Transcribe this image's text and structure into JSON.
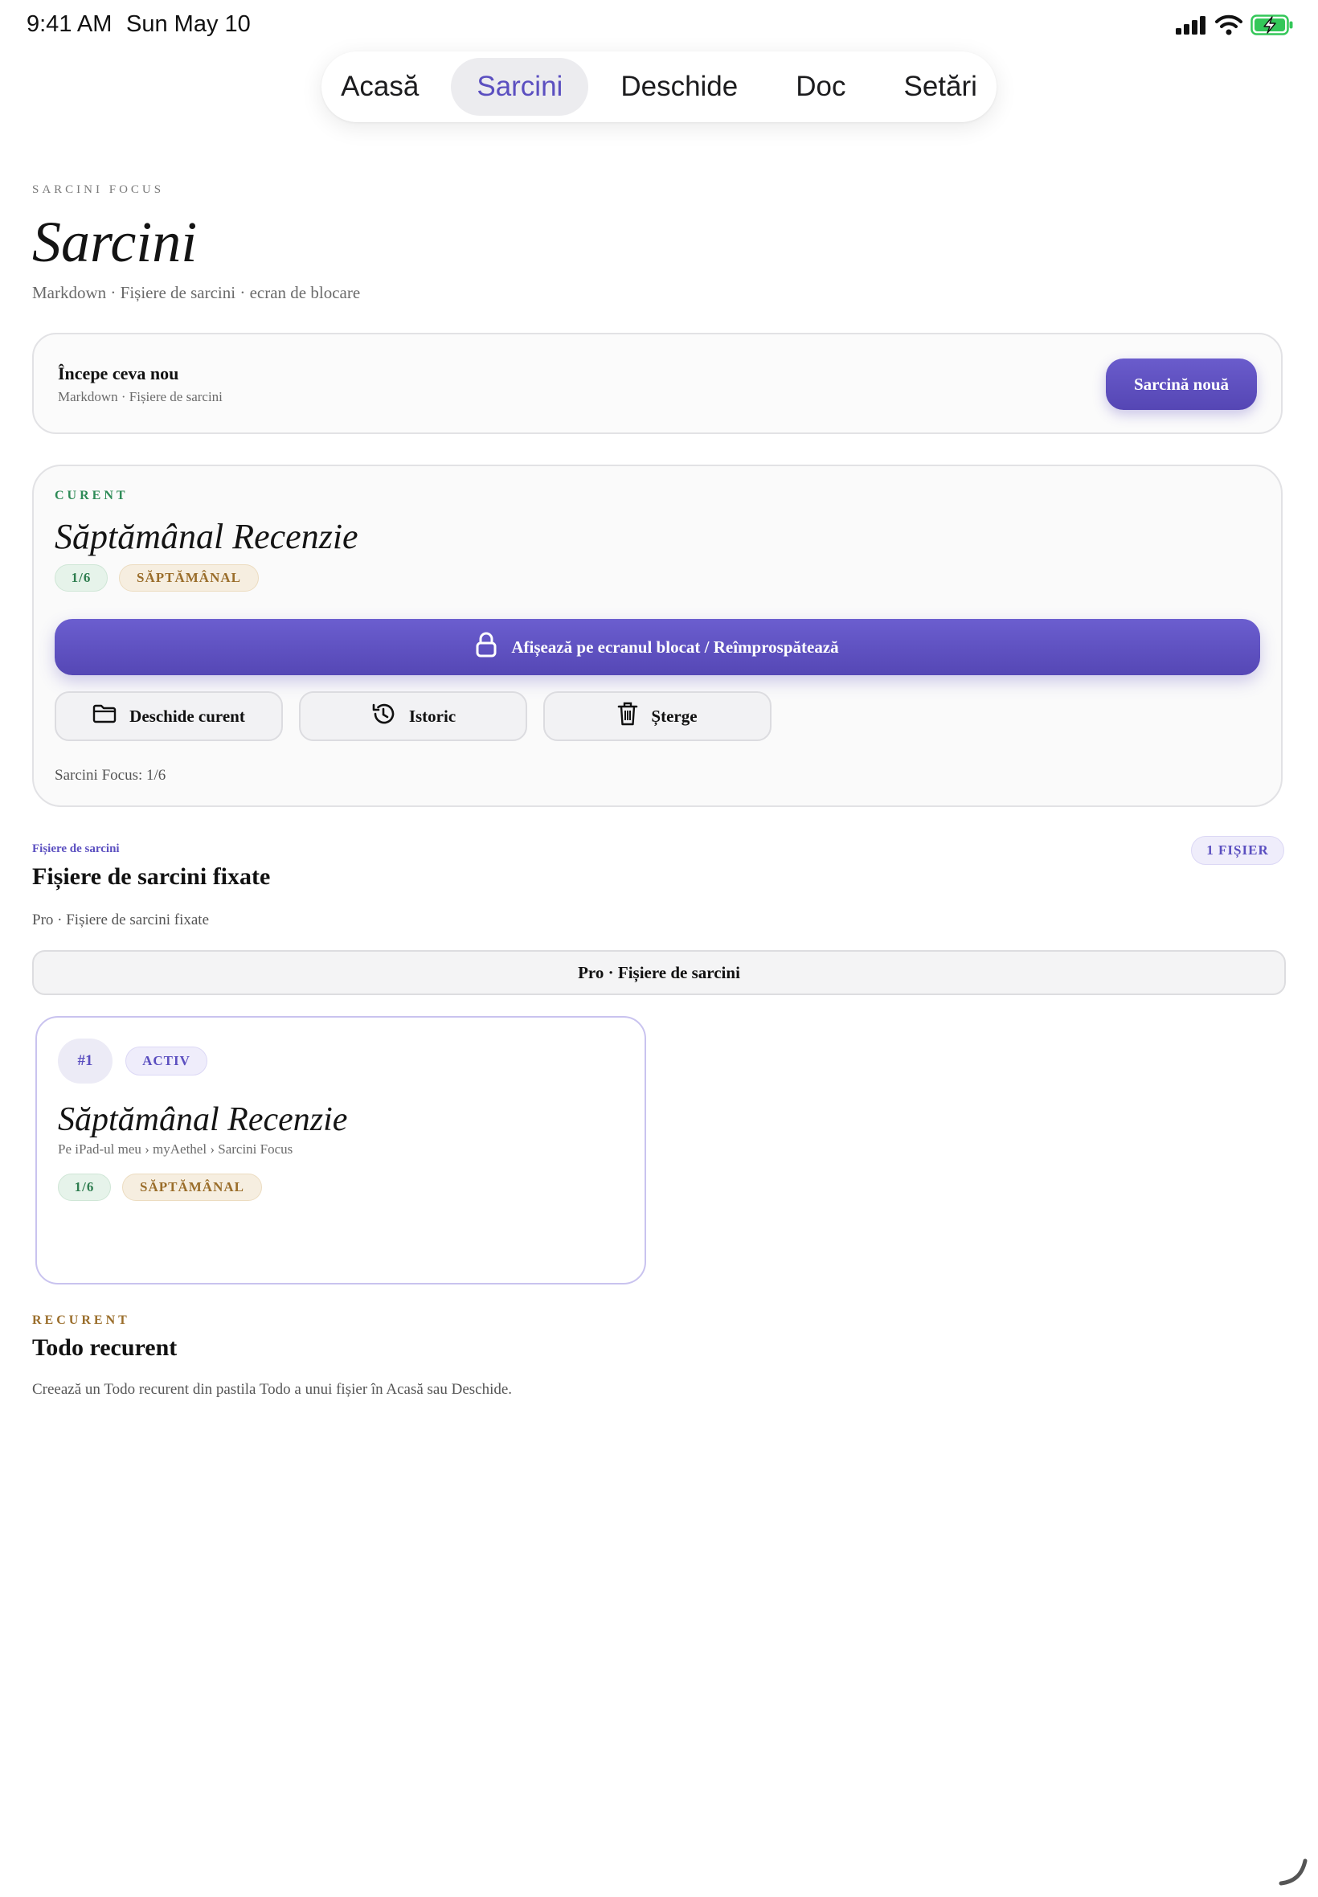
{
  "status_bar": {
    "time": "9:41 AM",
    "date": "Sun May 10"
  },
  "tabs": [
    {
      "label": "Acasă",
      "active": false
    },
    {
      "label": "Sarcini",
      "active": true
    },
    {
      "label": "Deschide",
      "active": false
    },
    {
      "label": "Doc",
      "active": false
    },
    {
      "label": "Setări",
      "active": false
    }
  ],
  "header": {
    "eyebrow": "SARCINI FOCUS",
    "title": "Sarcini",
    "subtitle": "Markdown · Fișiere de sarcini · ecran de blocare"
  },
  "start_card": {
    "title": "Începe ceva nou",
    "subtitle": "Markdown · Fișiere de sarcini",
    "button_label": "Sarcină nouă"
  },
  "current": {
    "eyebrow": "CURENT",
    "title": "Săptămânal Recenzie",
    "progress_chip": "1/6",
    "frequency_chip": "SĂPTĂMÂNAL",
    "lock_button": "Afișează pe ecranul blocat / Reîmprospătează",
    "open_button": "Deschide curent",
    "history_button": "Istoric",
    "delete_button": "Șterge",
    "footer": "Sarcini Focus: 1/6"
  },
  "pinned": {
    "eyebrow": "Fișiere de sarcini",
    "title": "Fișiere de sarcini fixate",
    "subtitle": "Pro · Fișiere de sarcini fixate",
    "count_badge": "1 FIȘIER",
    "pro_banner": "Pro · Fișiere de sarcini",
    "files": [
      {
        "number": "#1",
        "status": "ACTIV",
        "title": "Săptămânal Recenzie",
        "path": "Pe iPad-ul meu › myAethel › Sarcini Focus",
        "progress_chip": "1/6",
        "frequency_chip": "SĂPTĂMÂNAL"
      }
    ]
  },
  "recurrent": {
    "eyebrow": "RECURENT",
    "title": "Todo recurent",
    "text": "Creează un Todo recurent din pastila Todo a unui fișier în Acasă sau Deschide."
  },
  "colors": {
    "accent": "#5b4fc0",
    "green": "#2e8b57",
    "gold": "#9a6d2a",
    "battery": "#34c759"
  },
  "icons": [
    "cellular-signal-icon",
    "wifi-icon",
    "battery-charging-icon",
    "lock-icon",
    "folder-icon",
    "history-icon",
    "trash-icon"
  ]
}
